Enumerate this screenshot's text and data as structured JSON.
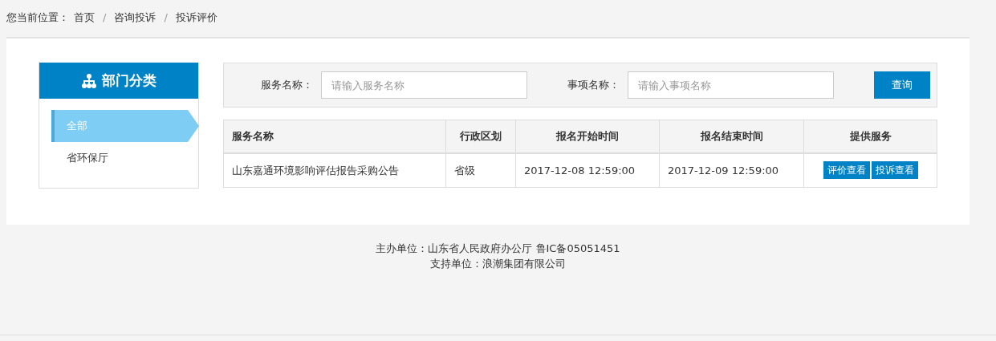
{
  "breadcrumb": {
    "label": "您当前位置：",
    "items": [
      "首页",
      "咨询投诉",
      "投诉评价"
    ],
    "separator": "/"
  },
  "sidebar": {
    "title": "部门分类",
    "items": [
      {
        "label": "全部",
        "selected": true
      },
      {
        "label": "省环保厅",
        "selected": false
      }
    ]
  },
  "search": {
    "fields": [
      {
        "label": "服务名称：",
        "placeholder": "请输入服务名称"
      },
      {
        "label": "事项名称：",
        "placeholder": "请输入事项名称"
      }
    ],
    "button": "查询"
  },
  "table": {
    "columns": [
      "服务名称",
      "行政区划",
      "报名开始时间",
      "报名结束时间",
      "提供服务"
    ],
    "rows": [
      {
        "cells": [
          "山东嘉通环境影响评估报告采购公告",
          "省级",
          "2017-12-08 12:59:00",
          "2017-12-09 12:59:00"
        ],
        "actions": [
          "评价查看",
          "投诉查看"
        ]
      }
    ]
  },
  "footer": [
    "主办单位：山东省人民政府办公厅 鲁IC备05051451",
    "支持单位：浪潮集团有限公司"
  ]
}
